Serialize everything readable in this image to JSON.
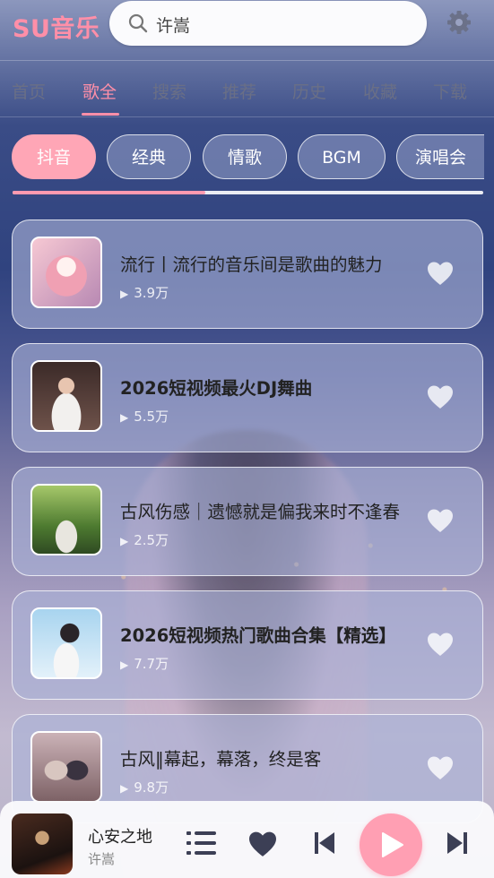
{
  "app": {
    "logo": "SU音乐"
  },
  "search": {
    "value": "许嵩"
  },
  "nav": {
    "tabs": [
      {
        "label": "首页",
        "active": false
      },
      {
        "label": "歌全",
        "active": true
      },
      {
        "label": "搜索",
        "active": false
      },
      {
        "label": "推荐",
        "active": false
      },
      {
        "label": "历史",
        "active": false
      },
      {
        "label": "收藏",
        "active": false
      },
      {
        "label": "下载",
        "active": false
      }
    ]
  },
  "categories": {
    "chips": [
      {
        "label": "抖音",
        "active": true
      },
      {
        "label": "经典",
        "active": false
      },
      {
        "label": "情歌",
        "active": false
      },
      {
        "label": "BGM",
        "active": false
      },
      {
        "label": "演唱会",
        "active": false
      }
    ],
    "scroll_fraction": 0.41
  },
  "playlists": [
    {
      "title": "流行丨流行的音乐间是歌曲的魅力",
      "plays": "3.9万",
      "bold": false
    },
    {
      "title": "2026短视频最火DJ舞曲",
      "plays": "5.5万",
      "bold": true
    },
    {
      "title": "古风伤感｜遗憾就是偏我来时不逢春",
      "plays": "2.5万",
      "bold": false
    },
    {
      "title": "2026短视频热门歌曲合集【精选】",
      "plays": "7.7万",
      "bold": true
    },
    {
      "title": "古风‖幕起，幕落，终是客",
      "plays": "9.8万",
      "bold": false
    }
  ],
  "player": {
    "song": "心安之地",
    "artist": "许嵩"
  },
  "colors": {
    "accent": "#ff8fa8",
    "chip_active": "#ffa6b6"
  }
}
